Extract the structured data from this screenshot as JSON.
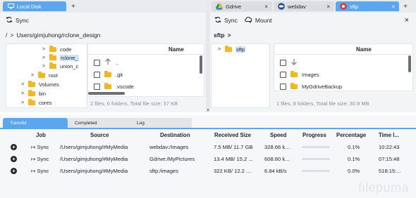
{
  "left": {
    "tabs": [
      {
        "label": "Local Disk"
      }
    ],
    "toolbar": {
      "sync": "Sync"
    },
    "breadcrumb": {
      "sep": "/",
      "arrow": ">",
      "path": "Users/gimjuhong/rclone_design"
    },
    "tree": [
      {
        "label": "code",
        "caret": ">"
      },
      {
        "label": "rclone_",
        "caret": ">"
      },
      {
        "label": "union_c",
        "caret": ">"
      },
      {
        "label": "root",
        "caret": ">"
      },
      {
        "label": "Volumes",
        "caret": ">"
      },
      {
        "label": "bin",
        "caret": ">"
      },
      {
        "label": "cores",
        "caret": ">"
      }
    ],
    "files": {
      "header": "Name",
      "rows": [
        {
          "name": ".."
        },
        {
          "name": ".git"
        },
        {
          "name": ".vscode"
        }
      ]
    },
    "status": "2 files, 6 folders, Total file size: 37 KB"
  },
  "right": {
    "tabs": [
      {
        "label": "Gdrive"
      },
      {
        "label": "webdav"
      },
      {
        "label": "sftp"
      }
    ],
    "toolbar": {
      "sync": "Sync",
      "mount": "Mount"
    },
    "breadcrumb": {
      "path": "sftp",
      "arrow": ">"
    },
    "tree": [
      {
        "label": "sftp",
        "caret": ">"
      }
    ],
    "files": {
      "header": "Name",
      "rows": [
        {
          "name": ""
        },
        {
          "name": "Images"
        },
        {
          "name": "MyGdriveBackup"
        }
      ]
    },
    "status": "1 files, 8 folders, Total file size: 30.9 MB"
  },
  "bottom": {
    "tabs": [
      "Transfer",
      "Completed",
      "Log"
    ],
    "columns": [
      "Job",
      "Source",
      "Destination",
      "Received Size",
      "Speed",
      "Progress",
      "Percentage",
      "Time l..."
    ],
    "rows": [
      {
        "job": "↦ Sync",
        "source": "/Users/gimjuhong/#MyMedia",
        "dest": "webdav:/Images",
        "received": "7.5 MB/ 11.7 GB",
        "speed": "328.66 k...",
        "pct": "0.1%",
        "time": "10:22:43"
      },
      {
        "job": "↦ Sync",
        "source": "/Users/gimjuhong/#MyMedia",
        "dest": "Gdrive:/MyPictures",
        "received": "13.4 MB/ 15.2 ...",
        "speed": "608.80 k...",
        "pct": "0.1%",
        "time": "07:15:48"
      },
      {
        "job": "↦ Sync",
        "source": "/Users/gimjuhong/#MyMedia",
        "dest": "sftp:/images",
        "received": "322 KB/ 12.2 ...",
        "speed": "6.84 kB/s",
        "pct": "0.0%",
        "time": "518:15:..."
      }
    ]
  },
  "watermark": "filepuma",
  "colors": {
    "accent": "#5aa7ef",
    "folder": "#f4b622"
  }
}
